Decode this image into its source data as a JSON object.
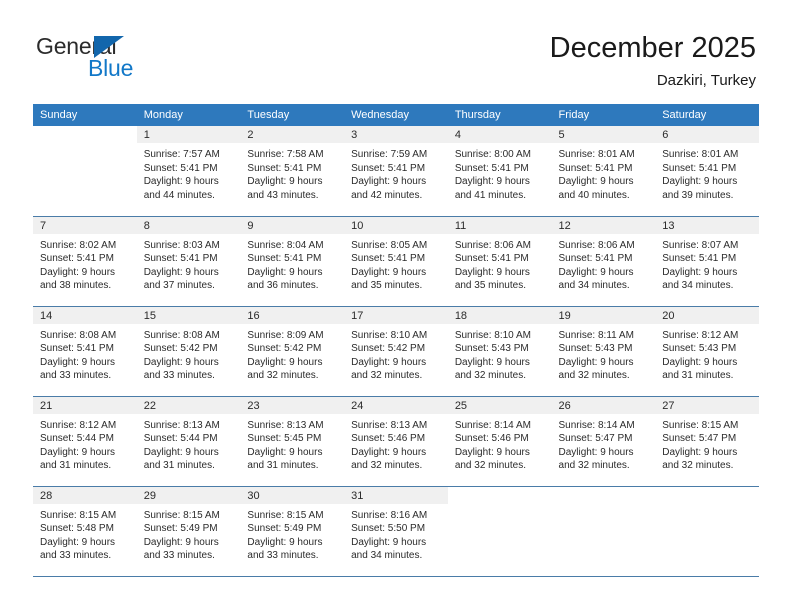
{
  "brand": {
    "name_top": "General",
    "name_bottom": "Blue",
    "triangle_color": "#1266ac",
    "blue_color": "#1278c8"
  },
  "header": {
    "title": "December 2025",
    "subtitle": "Dazkiri, Turkey",
    "header_bg": "#2e79bd",
    "daynum_bg": "#f0f0f0",
    "grid_line": "#4a7ca8"
  },
  "weekdays": [
    "Sunday",
    "Monday",
    "Tuesday",
    "Wednesday",
    "Thursday",
    "Friday",
    "Saturday"
  ],
  "chart_data": {
    "type": "table",
    "title": "December 2025",
    "subtitle": "Dazkiri, Turkey",
    "columns": [
      "Sunday",
      "Monday",
      "Tuesday",
      "Wednesday",
      "Thursday",
      "Friday",
      "Saturday"
    ],
    "days": [
      {
        "day": 1,
        "sunrise": "7:57 AM",
        "sunset": "5:41 PM",
        "daylight_hours": 9,
        "daylight_minutes": 44
      },
      {
        "day": 2,
        "sunrise": "7:58 AM",
        "sunset": "5:41 PM",
        "daylight_hours": 9,
        "daylight_minutes": 43
      },
      {
        "day": 3,
        "sunrise": "7:59 AM",
        "sunset": "5:41 PM",
        "daylight_hours": 9,
        "daylight_minutes": 42
      },
      {
        "day": 4,
        "sunrise": "8:00 AM",
        "sunset": "5:41 PM",
        "daylight_hours": 9,
        "daylight_minutes": 41
      },
      {
        "day": 5,
        "sunrise": "8:01 AM",
        "sunset": "5:41 PM",
        "daylight_hours": 9,
        "daylight_minutes": 40
      },
      {
        "day": 6,
        "sunrise": "8:01 AM",
        "sunset": "5:41 PM",
        "daylight_hours": 9,
        "daylight_minutes": 39
      },
      {
        "day": 7,
        "sunrise": "8:02 AM",
        "sunset": "5:41 PM",
        "daylight_hours": 9,
        "daylight_minutes": 38
      },
      {
        "day": 8,
        "sunrise": "8:03 AM",
        "sunset": "5:41 PM",
        "daylight_hours": 9,
        "daylight_minutes": 37
      },
      {
        "day": 9,
        "sunrise": "8:04 AM",
        "sunset": "5:41 PM",
        "daylight_hours": 9,
        "daylight_minutes": 36
      },
      {
        "day": 10,
        "sunrise": "8:05 AM",
        "sunset": "5:41 PM",
        "daylight_hours": 9,
        "daylight_minutes": 35
      },
      {
        "day": 11,
        "sunrise": "8:06 AM",
        "sunset": "5:41 PM",
        "daylight_hours": 9,
        "daylight_minutes": 35
      },
      {
        "day": 12,
        "sunrise": "8:06 AM",
        "sunset": "5:41 PM",
        "daylight_hours": 9,
        "daylight_minutes": 34
      },
      {
        "day": 13,
        "sunrise": "8:07 AM",
        "sunset": "5:41 PM",
        "daylight_hours": 9,
        "daylight_minutes": 34
      },
      {
        "day": 14,
        "sunrise": "8:08 AM",
        "sunset": "5:41 PM",
        "daylight_hours": 9,
        "daylight_minutes": 33
      },
      {
        "day": 15,
        "sunrise": "8:08 AM",
        "sunset": "5:42 PM",
        "daylight_hours": 9,
        "daylight_minutes": 33
      },
      {
        "day": 16,
        "sunrise": "8:09 AM",
        "sunset": "5:42 PM",
        "daylight_hours": 9,
        "daylight_minutes": 32
      },
      {
        "day": 17,
        "sunrise": "8:10 AM",
        "sunset": "5:42 PM",
        "daylight_hours": 9,
        "daylight_minutes": 32
      },
      {
        "day": 18,
        "sunrise": "8:10 AM",
        "sunset": "5:43 PM",
        "daylight_hours": 9,
        "daylight_minutes": 32
      },
      {
        "day": 19,
        "sunrise": "8:11 AM",
        "sunset": "5:43 PM",
        "daylight_hours": 9,
        "daylight_minutes": 32
      },
      {
        "day": 20,
        "sunrise": "8:12 AM",
        "sunset": "5:43 PM",
        "daylight_hours": 9,
        "daylight_minutes": 31
      },
      {
        "day": 21,
        "sunrise": "8:12 AM",
        "sunset": "5:44 PM",
        "daylight_hours": 9,
        "daylight_minutes": 31
      },
      {
        "day": 22,
        "sunrise": "8:13 AM",
        "sunset": "5:44 PM",
        "daylight_hours": 9,
        "daylight_minutes": 31
      },
      {
        "day": 23,
        "sunrise": "8:13 AM",
        "sunset": "5:45 PM",
        "daylight_hours": 9,
        "daylight_minutes": 31
      },
      {
        "day": 24,
        "sunrise": "8:13 AM",
        "sunset": "5:46 PM",
        "daylight_hours": 9,
        "daylight_minutes": 32
      },
      {
        "day": 25,
        "sunrise": "8:14 AM",
        "sunset": "5:46 PM",
        "daylight_hours": 9,
        "daylight_minutes": 32
      },
      {
        "day": 26,
        "sunrise": "8:14 AM",
        "sunset": "5:47 PM",
        "daylight_hours": 9,
        "daylight_minutes": 32
      },
      {
        "day": 27,
        "sunrise": "8:15 AM",
        "sunset": "5:47 PM",
        "daylight_hours": 9,
        "daylight_minutes": 32
      },
      {
        "day": 28,
        "sunrise": "8:15 AM",
        "sunset": "5:48 PM",
        "daylight_hours": 9,
        "daylight_minutes": 33
      },
      {
        "day": 29,
        "sunrise": "8:15 AM",
        "sunset": "5:49 PM",
        "daylight_hours": 9,
        "daylight_minutes": 33
      },
      {
        "day": 30,
        "sunrise": "8:15 AM",
        "sunset": "5:49 PM",
        "daylight_hours": 9,
        "daylight_minutes": 33
      },
      {
        "day": 31,
        "sunrise": "8:16 AM",
        "sunset": "5:50 PM",
        "daylight_hours": 9,
        "daylight_minutes": 34
      }
    ],
    "first_weekday_index": 1,
    "labels": {
      "sunrise_prefix": "Sunrise: ",
      "sunset_prefix": "Sunset: ",
      "daylight_prefix": "Daylight: ",
      "hours_word": "hours",
      "and_word": "and",
      "minutes_word": "minutes."
    }
  }
}
